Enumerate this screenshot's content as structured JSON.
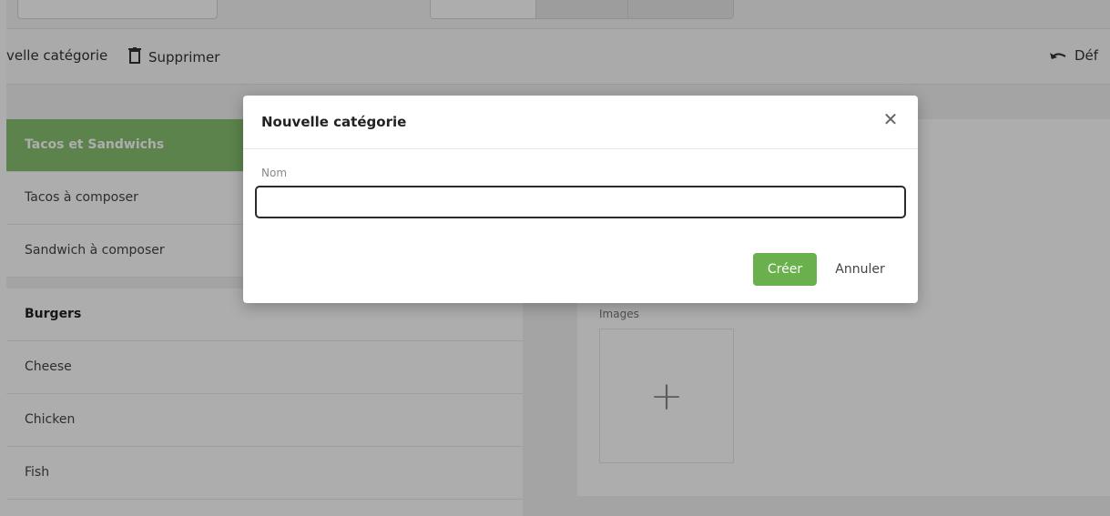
{
  "toolbar": {
    "new_category_label": "velle catégorie",
    "delete_label": "Supprimer",
    "undo_label": "Déf"
  },
  "categories": [
    {
      "label": "Tacos et Sandwichs"
    },
    {
      "label": "Tacos à composer"
    },
    {
      "label": "Sandwich à composer"
    },
    {
      "label": "Burgers"
    },
    {
      "label": "Cheese"
    },
    {
      "label": "Chicken"
    },
    {
      "label": "Fish"
    }
  ],
  "editor": {
    "images_label": "Images",
    "add_image_symbol": "+"
  },
  "modal": {
    "title": "Nouvelle catégorie",
    "close_symbol": "✕",
    "name_label": "Nom",
    "name_value": "",
    "create_label": "Créer",
    "cancel_label": "Annuler"
  },
  "colors": {
    "accent": "#6ab04c",
    "active_item": "#86c26f"
  }
}
